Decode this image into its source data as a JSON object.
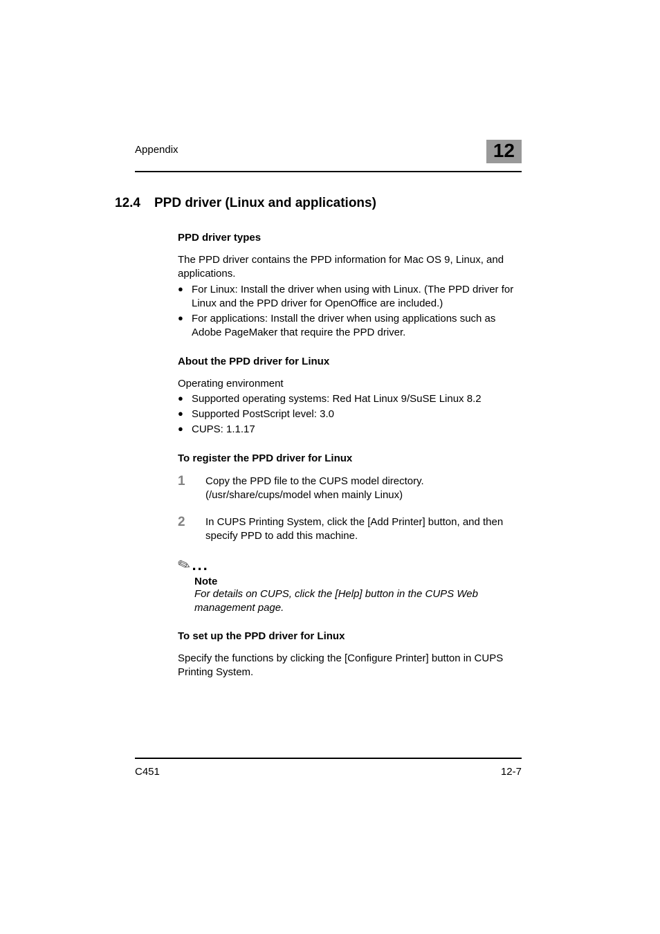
{
  "header": {
    "label": "Appendix",
    "chapter_number": "12"
  },
  "section": {
    "number": "12.4",
    "title": "PPD driver (Linux and applications)"
  },
  "body": {
    "sub1": {
      "heading": "PPD driver types",
      "intro": "The PPD driver contains the PPD information for Mac OS 9, Linux, and applications.",
      "bullets": [
        "For Linux: Install the driver when using with Linux. (The PPD driver for Linux and the PPD driver for OpenOffice are included.)",
        "For applications: Install the driver when using applications such as Adobe PageMaker that require the PPD driver."
      ]
    },
    "sub2": {
      "heading": "About the PPD driver for Linux",
      "intro": "Operating environment",
      "bullets": [
        "Supported operating systems: Red Hat Linux 9/SuSE Linux 8.2",
        "Supported PostScript level: 3.0",
        "CUPS: 1.1.17"
      ]
    },
    "sub3": {
      "heading": "To register the PPD driver for Linux",
      "steps": [
        "Copy the PPD file to the CUPS model directory. (/usr/share/cups/model when mainly Linux)",
        "In CUPS Printing System, click the [Add Printer] button, and then specify PPD to add this machine."
      ]
    },
    "note": {
      "title": "Note",
      "text": "For details on CUPS, click the [Help] button in the CUPS Web management page."
    },
    "sub4": {
      "heading": "To set up the PPD driver for Linux",
      "para": "Specify the functions by clicking the [Configure Printer] button in CUPS Printing System."
    }
  },
  "footer": {
    "left": "C451",
    "right": "12-7"
  }
}
